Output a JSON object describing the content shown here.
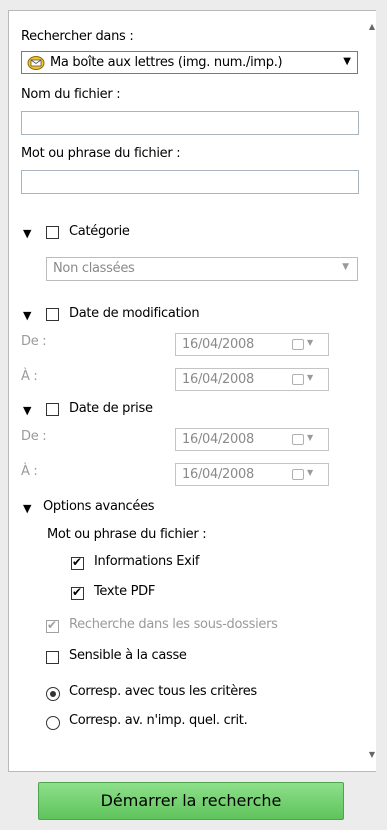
{
  "search_in": {
    "label": "Rechercher dans :",
    "selected": "Ma boîte aux lettres (img. num./imp.)"
  },
  "filename": {
    "label": "Nom du fichier :",
    "value": ""
  },
  "word_phrase": {
    "label": "Mot ou phrase du fichier :",
    "value": ""
  },
  "category": {
    "label": "Catégorie",
    "checked": false,
    "selected": "Non classées"
  },
  "modified_date": {
    "label": "Date de modification",
    "checked": false,
    "from_label": "De :",
    "to_label": "À :",
    "from": "16/04/2008",
    "to": "16/04/2008"
  },
  "shot_date": {
    "label": "Date de prise",
    "checked": false,
    "from_label": "De :",
    "to_label": "À :",
    "from": "16/04/2008",
    "to": "16/04/2008"
  },
  "advanced": {
    "label": "Options avancées",
    "word_phrase_label": "Mot ou phrase du fichier :",
    "exif_label": "Informations Exif",
    "exif_checked": true,
    "pdf_label": "Texte PDF",
    "pdf_checked": true,
    "subfolders_label": "Recherche dans les sous-dossiers",
    "subfolders_checked": true,
    "case_label": "Sensible à la casse",
    "case_checked": false,
    "match_all_label": "Corresp. avec tous les critères",
    "match_any_label": "Corresp. av. n'imp. quel. crit.",
    "match_selected": "all"
  },
  "start_button": "Démarrer la recherche",
  "colors": {
    "button_green": "#6fcf6b",
    "border": "#b9b9b9"
  }
}
